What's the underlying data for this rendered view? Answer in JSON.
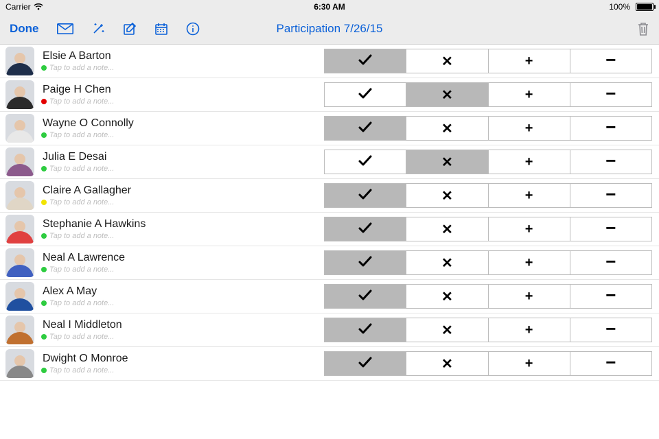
{
  "status": {
    "carrier": "Carrier",
    "time": "6:30 AM",
    "battery": "100%"
  },
  "nav": {
    "done": "Done",
    "title": "Participation 7/26/15"
  },
  "note_placeholder": "Tap to add a note...",
  "dot_colors": {
    "green": "#2ecc40",
    "red": "#e40000",
    "yellow": "#f1e402"
  },
  "shirt_colors": [
    "#1e2e4a",
    "#2b2b2b",
    "#e8e8e8",
    "#8c5a8c",
    "#e0d6c6",
    "#e04040",
    "#4060c0",
    "#2050a0",
    "#c07030",
    "#888888"
  ],
  "rows": [
    {
      "name": "Elsie A Barton",
      "dot": "green",
      "selected": "check"
    },
    {
      "name": "Paige H Chen",
      "dot": "red",
      "selected": "x"
    },
    {
      "name": "Wayne O Connolly",
      "dot": "green",
      "selected": "check"
    },
    {
      "name": "Julia E Desai",
      "dot": "green",
      "selected": "x"
    },
    {
      "name": "Claire A Gallagher",
      "dot": "yellow",
      "selected": "check"
    },
    {
      "name": "Stephanie A Hawkins",
      "dot": "green",
      "selected": "check"
    },
    {
      "name": "Neal A Lawrence",
      "dot": "green",
      "selected": "check"
    },
    {
      "name": "Alex A May",
      "dot": "green",
      "selected": "check"
    },
    {
      "name": "Neal I Middleton",
      "dot": "green",
      "selected": "check"
    },
    {
      "name": "Dwight O Monroe",
      "dot": "green",
      "selected": "check"
    }
  ]
}
